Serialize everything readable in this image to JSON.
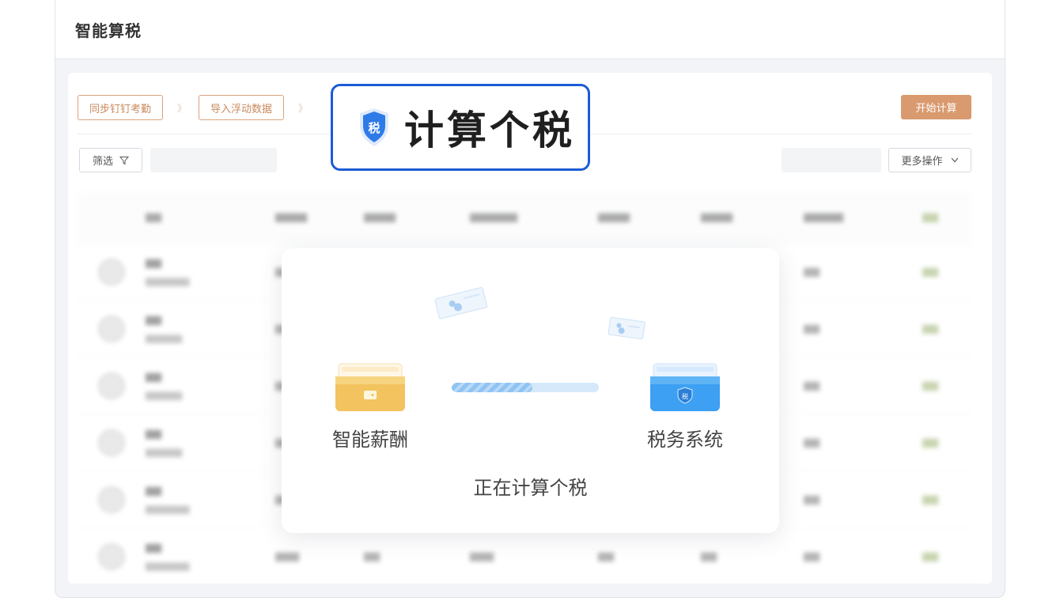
{
  "window": {
    "title": "智能算税"
  },
  "steps": {
    "items": [
      "同步钉钉考勤",
      "导入浮动数据"
    ],
    "arrow": "》",
    "start_label": "开始计算"
  },
  "toolbar": {
    "filter_label": "筛选",
    "more_label": "更多操作"
  },
  "modal": {
    "source_label": "智能薪酬",
    "target_label": "税务系统",
    "status": "正在计算个税",
    "progress": 0.55
  },
  "badge": {
    "text": "计算个税",
    "shield_char": "税"
  },
  "colors": {
    "accent": "#d99a6f",
    "badge_border": "#1a5cd7",
    "progress": "#8fc3f2"
  },
  "icons": [
    "funnel-icon",
    "chevron-down-icon",
    "wallet-icon",
    "tax-folder-icon",
    "shield-icon",
    "document-icon"
  ]
}
